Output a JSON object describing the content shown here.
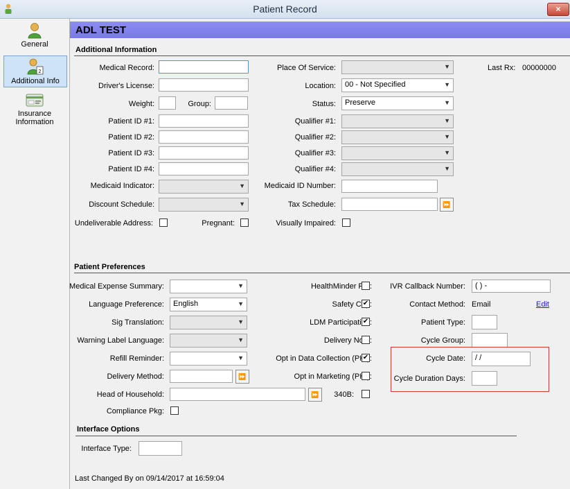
{
  "window": {
    "title": "Patient Record",
    "close_symbol": "×"
  },
  "sidebar": {
    "items": [
      {
        "label": "General",
        "icon": "person-icon"
      },
      {
        "label": "Additional Info",
        "icon": "person-info-icon"
      },
      {
        "label_line1": "Insurance",
        "label_line2": "Information",
        "icon": "insurance-card-icon"
      }
    ]
  },
  "patient": {
    "name": "ADL TEST"
  },
  "additional_info": {
    "heading": "Additional Information",
    "medical_record": {
      "label": "Medical Record:",
      "value": ""
    },
    "drivers_license": {
      "label": "Driver's License:",
      "value": ""
    },
    "weight": {
      "label": "Weight:",
      "value": ""
    },
    "group": {
      "label": "Group:",
      "value": ""
    },
    "patient_id_1": {
      "label": "Patient ID #1:",
      "value": ""
    },
    "patient_id_2": {
      "label": "Patient ID #2:",
      "value": ""
    },
    "patient_id_3": {
      "label": "Patient ID #3:",
      "value": ""
    },
    "patient_id_4": {
      "label": "Patient ID #4:",
      "value": ""
    },
    "medicaid_indicator": {
      "label": "Medicaid Indicator:",
      "value": ""
    },
    "discount_schedule": {
      "label": "Discount Schedule:",
      "value": ""
    },
    "undeliverable_address": {
      "label": "Undeliverable Address:",
      "checked": false
    },
    "pregnant": {
      "label": "Pregnant:",
      "checked": false
    },
    "place_of_service": {
      "label": "Place Of Service:",
      "value": ""
    },
    "location": {
      "label": "Location:",
      "value": "00 - Not Specified"
    },
    "status": {
      "label": "Status:",
      "value": "Preserve"
    },
    "qualifier_1": {
      "label": "Qualifier #1:",
      "value": ""
    },
    "qualifier_2": {
      "label": "Qualifier #2:",
      "value": ""
    },
    "qualifier_3": {
      "label": "Qualifier #3:",
      "value": ""
    },
    "qualifier_4": {
      "label": "Qualifier #4:",
      "value": ""
    },
    "medicaid_id_number": {
      "label": "Medicaid ID Number:",
      "value": ""
    },
    "tax_schedule": {
      "label": "Tax Schedule:",
      "value": ""
    },
    "visually_impaired": {
      "label": "Visually Impaired:",
      "checked": false
    },
    "last_rx": {
      "label": "Last Rx:",
      "value": "00000000"
    }
  },
  "preferences": {
    "heading": "Patient Preferences",
    "medical_expense_summary": {
      "label": "Medical Expense Summary:",
      "value": ""
    },
    "language_preference": {
      "label": "Language Preference:",
      "value": "English"
    },
    "sig_translation": {
      "label": "Sig Translation:",
      "value": ""
    },
    "warning_label_language": {
      "label": "Warning Label Language:",
      "value": ""
    },
    "refill_reminder": {
      "label": "Refill Reminder:",
      "value": ""
    },
    "delivery_method": {
      "label": "Delivery Method:",
      "value": ""
    },
    "head_of_household": {
      "label": "Head of Household:",
      "value": ""
    },
    "compliance_pkg": {
      "label": "Compliance Pkg:",
      "checked": false
    },
    "healthminder_pat": {
      "label": "HealthMinder Pat:",
      "checked": false
    },
    "safety_cap": {
      "label": "Safety Cap:",
      "checked": true
    },
    "ldm_participation": {
      "label": "LDM Participation:",
      "checked": true
    },
    "delivery_note": {
      "label": "Delivery Note:",
      "checked": false
    },
    "opt_in_data_collection": {
      "label": "Opt in Data Collection (PHI):",
      "checked": true
    },
    "opt_in_marketing": {
      "label": "Opt in Marketing (PHI):",
      "checked": false
    },
    "b340": {
      "label": "340B:",
      "checked": false
    },
    "ivr_callback_number": {
      "label": "IVR Callback Number:",
      "value": "(  )    -"
    },
    "contact_method": {
      "label": "Contact Method:",
      "value": "Email",
      "edit_label": "Edit"
    },
    "patient_type": {
      "label": "Patient Type:",
      "value": ""
    },
    "cycle_group": {
      "label": "Cycle Group:",
      "value": ""
    },
    "cycle_date": {
      "label": "Cycle Date:",
      "value": " /  /"
    },
    "cycle_duration_days": {
      "label": "Cycle Duration Days:",
      "value": ""
    }
  },
  "interface": {
    "heading": "Interface Options",
    "interface_type": {
      "label": "Interface Type:",
      "value": ""
    }
  },
  "footer": {
    "last_changed": "Last Changed By  on 09/14/2017 at 16:59:04"
  },
  "glyphs": {
    "dropdown": "▼",
    "forward": "⏩",
    "check": "✔"
  },
  "colors": {
    "header": "#8080ee",
    "highlight_box": "#d23a3a",
    "link": "#1a1ad8"
  }
}
